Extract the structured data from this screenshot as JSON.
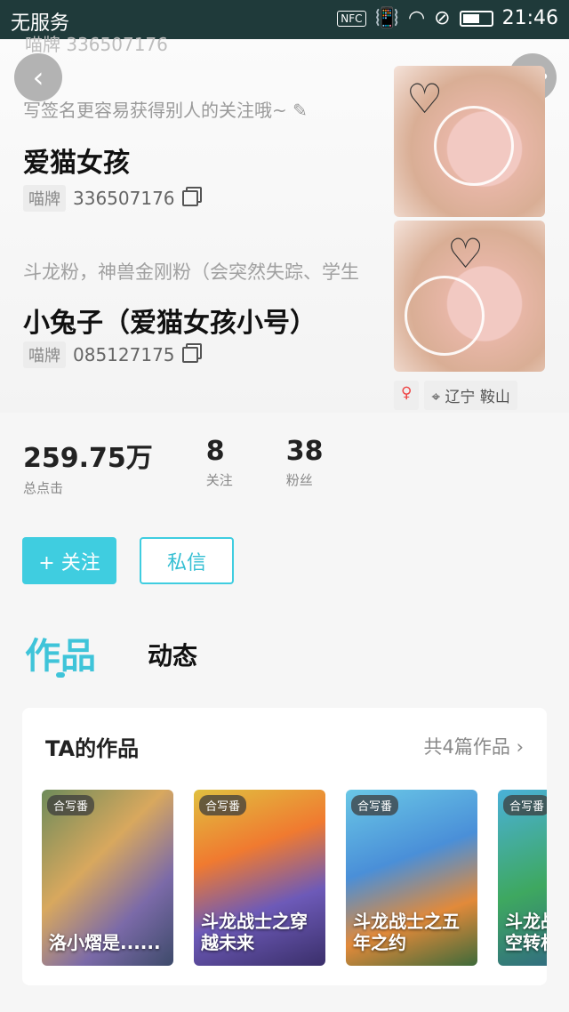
{
  "status": {
    "carrier": "无服务",
    "nfc": "NFC",
    "time": "21:46"
  },
  "profile": {
    "ghost_id_text": "喵牌 336507176",
    "signature_placeholder": "写签名更容易获得别人的关注哦~",
    "name": "爱猫女孩",
    "id_tag": "喵牌",
    "id_value": "336507176",
    "signature2": "斗龙粉，神兽金刚粉（会突然失踪、学生",
    "alt_name": "小兔子（爱猫女孩小号）",
    "alt_id_tag": "喵牌",
    "alt_id_value": "085127175",
    "gender": "♀",
    "location": "辽宁 鞍山"
  },
  "stats": [
    {
      "value": "259.75万",
      "label": "总点击"
    },
    {
      "value": "8",
      "label": "关注"
    },
    {
      "value": "38",
      "label": "粉丝"
    }
  ],
  "actions": {
    "follow": "+ 关注",
    "message": "私信"
  },
  "tabs": {
    "works": "作品",
    "activity": "动态"
  },
  "works_card": {
    "title": "TA的作品",
    "count": "共4篇作品",
    "items": [
      {
        "badge": "合写番",
        "title": "洛小熠是......"
      },
      {
        "badge": "合写番",
        "title": "斗龙战士之穿越未来"
      },
      {
        "badge": "合写番",
        "title": "斗龙战士之五年之约"
      },
      {
        "badge": "合写番",
        "title": "斗龙战士之时空转机"
      }
    ]
  }
}
